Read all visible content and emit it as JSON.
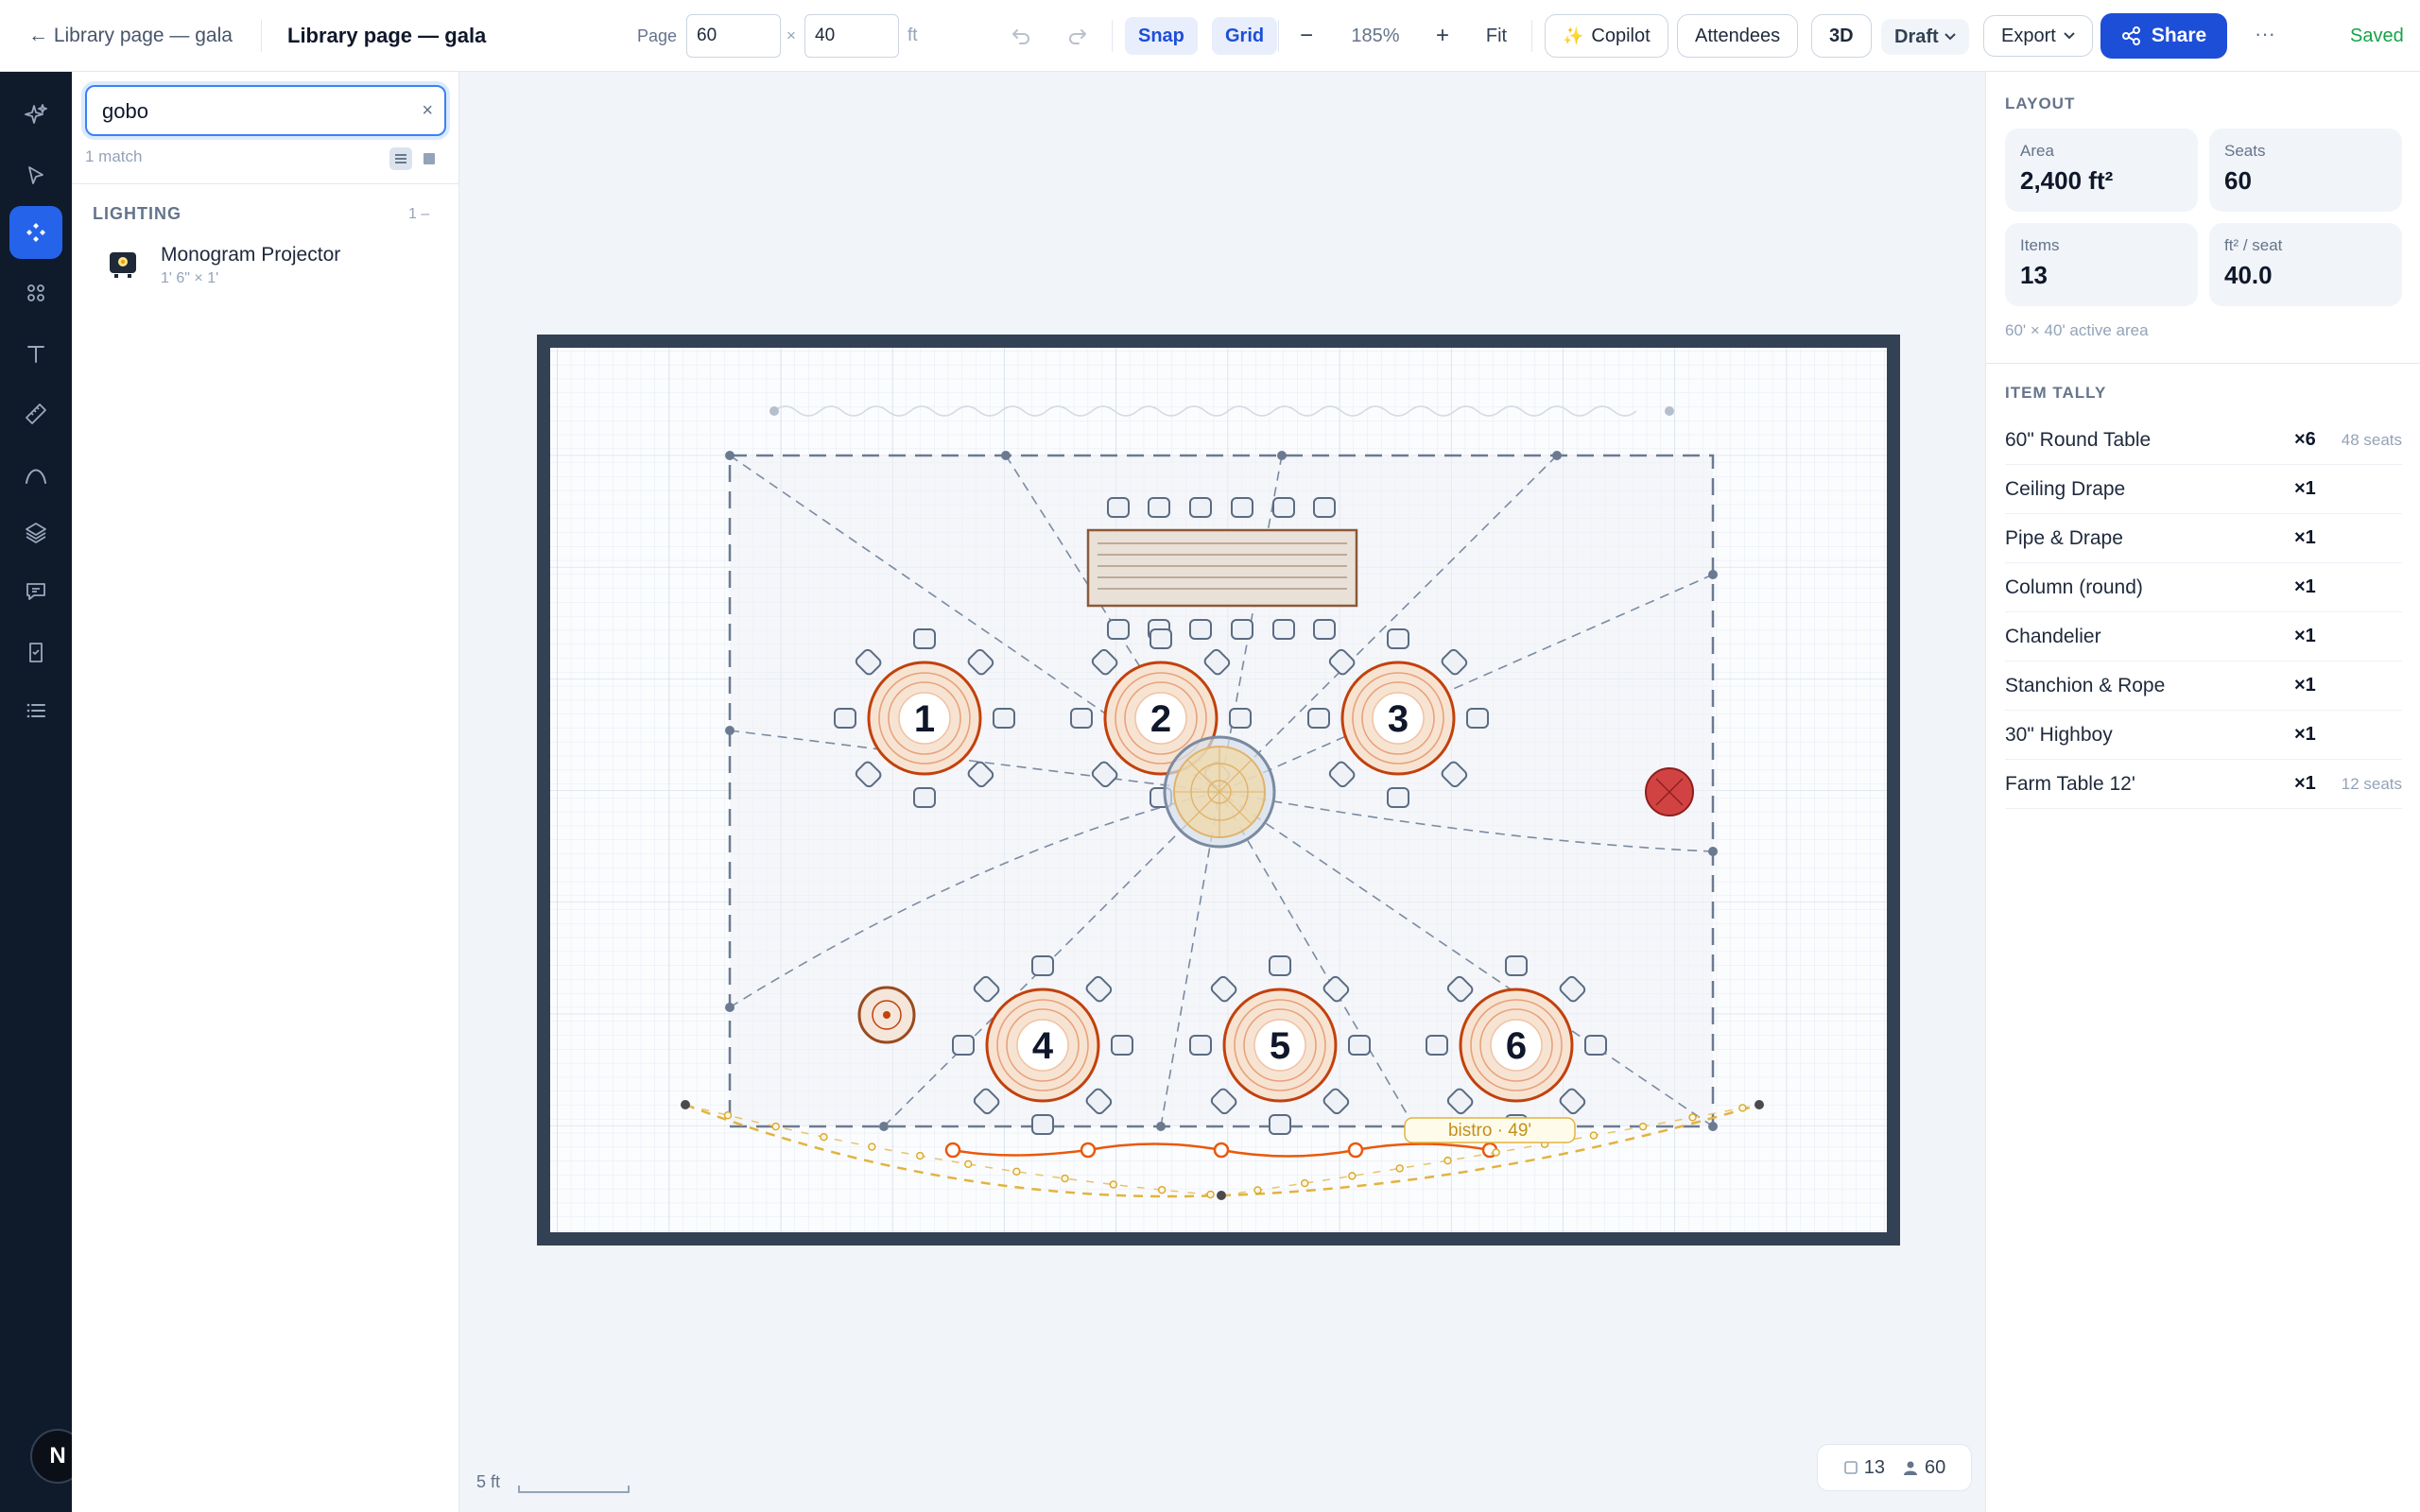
{
  "topbar": {
    "back_label": "← Library page — gala",
    "doc_title": "Library page — gala",
    "page_label": "Page",
    "page_width": "60",
    "page_height": "40",
    "times_symbol": "×",
    "unit": "ft",
    "snap_label": "Snap",
    "grid_label": "Grid",
    "zoom_out": "−",
    "zoom_level": "185%",
    "zoom_in": "+",
    "fit_label": "Fit",
    "copilot_label": "Copilot",
    "attendees_label": "Attendees",
    "three_d_label": "3D",
    "draft_label": "Draft",
    "export_label": "Export",
    "share_label": "Share",
    "more_label": "···",
    "saved_label": "Saved"
  },
  "rail": {
    "items": [
      "ai-sparkle",
      "select",
      "components",
      "apps",
      "text",
      "measure",
      "curve",
      "layers",
      "comments",
      "checklist",
      "outline"
    ],
    "active": "components",
    "avatar_initial": "N"
  },
  "library": {
    "search_value": "gobo",
    "clear_symbol": "×",
    "match_text": "1 match",
    "section": {
      "title": "LIGHTING",
      "count": "1 –"
    },
    "items": [
      {
        "name": "Monogram Projector",
        "dims": "1' 6\" × 1'"
      }
    ]
  },
  "canvas": {
    "tables": [
      "1",
      "2",
      "3",
      "4",
      "5",
      "6"
    ],
    "bistro_label": "bistro · 49'",
    "scale_label": "5 ft",
    "item_count": "13",
    "guest_count": "60"
  },
  "layout": {
    "heading": "LAYOUT",
    "stats": [
      {
        "label": "Area",
        "value": "2,400 ft²"
      },
      {
        "label": "Seats",
        "value": "60"
      },
      {
        "label": "Items",
        "value": "13"
      },
      {
        "label": "ft² / seat",
        "value": "40.0"
      }
    ],
    "area_note": "60' × 40' active area"
  },
  "tally": {
    "heading": "ITEM TALLY",
    "rows": [
      {
        "name": "60\" Round Table",
        "qty": "×6",
        "seats": "48 seats"
      },
      {
        "name": "Ceiling Drape",
        "qty": "×1",
        "seats": ""
      },
      {
        "name": "Pipe & Drape",
        "qty": "×1",
        "seats": ""
      },
      {
        "name": "Column (round)",
        "qty": "×1",
        "seats": ""
      },
      {
        "name": "Chandelier",
        "qty": "×1",
        "seats": ""
      },
      {
        "name": "Stanchion & Rope",
        "qty": "×1",
        "seats": ""
      },
      {
        "name": "30\" Highboy",
        "qty": "×1",
        "seats": ""
      },
      {
        "name": "Farm Table 12'",
        "qty": "×1",
        "seats": "12 seats"
      }
    ]
  },
  "colors": {
    "accent": "#1d4ed8",
    "table": "#c2410c",
    "drape": "#eab308",
    "rail": "#0f1a2b",
    "saved": "#16a34a"
  }
}
